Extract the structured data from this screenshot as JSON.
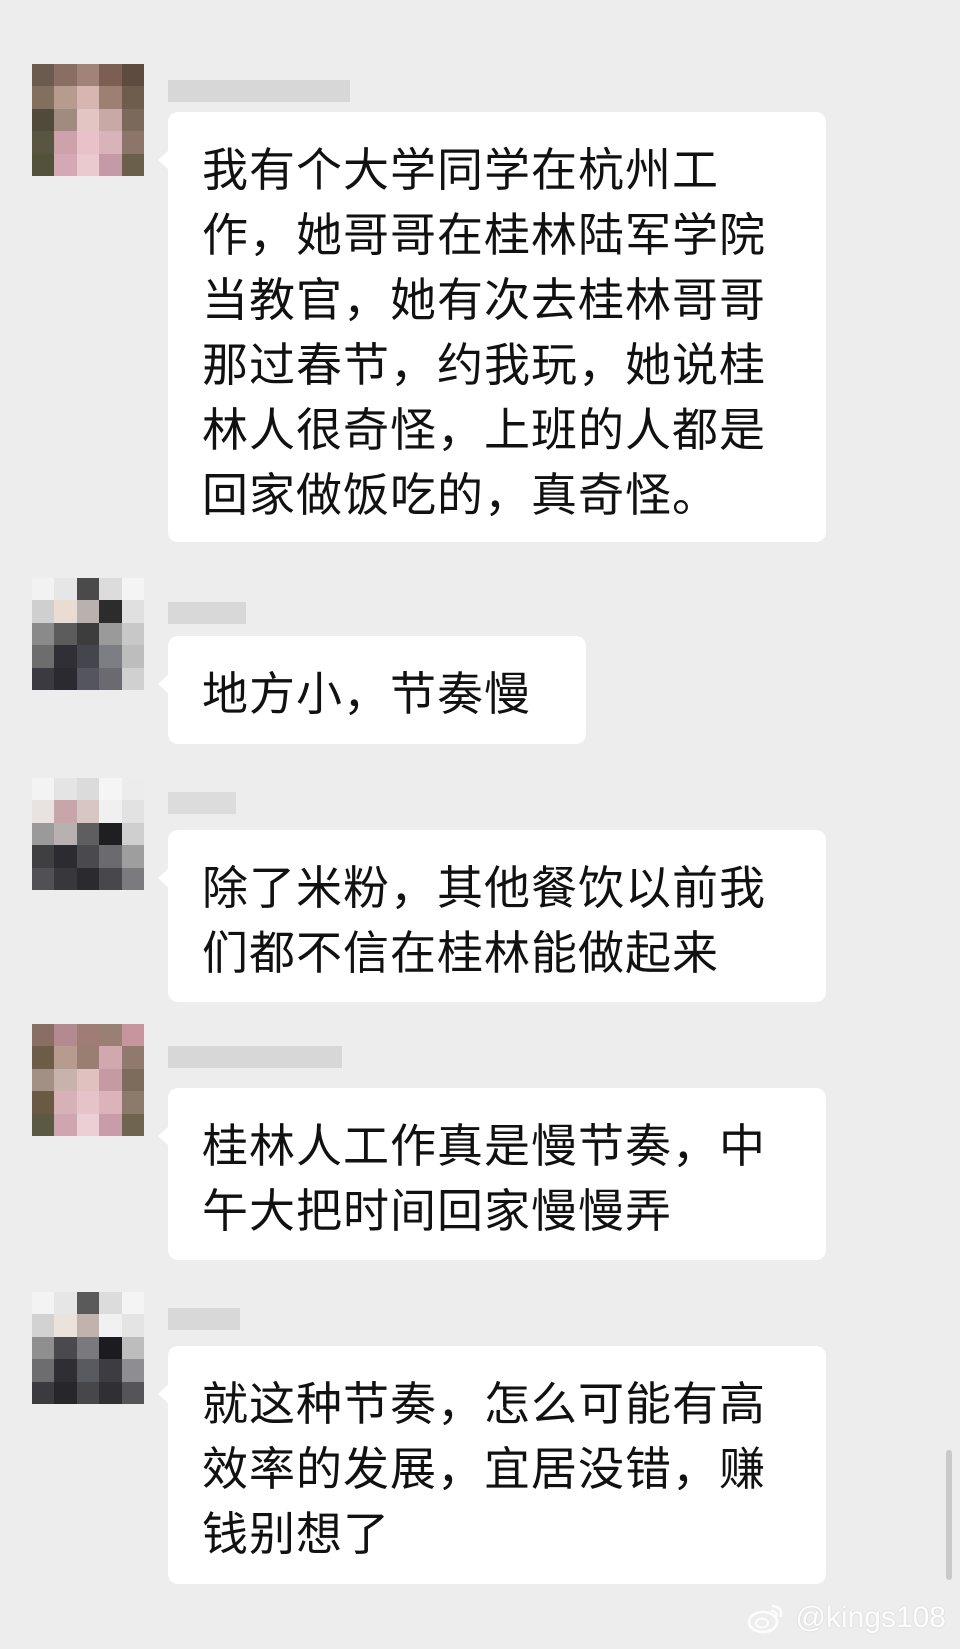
{
  "chat": {
    "messages": [
      {
        "text": "我有个大学同学在杭州工作，她哥哥在桂林陆军学院当教官，她有次去桂林哥哥那过春节，约我玩，她说桂林人很奇怪，上班的人都是回家做饭吃的，真奇怪。"
      },
      {
        "text": "地方小，节奏慢"
      },
      {
        "text": "除了米粉，其他餐饮以前我们都不信在桂林能做起来"
      },
      {
        "text": "桂林人工作真是慢节奏，中午大把时间回家慢慢弄"
      },
      {
        "text": "就这种节奏，怎么可能有高效率的发展，宜居没错，赚钱别想了"
      }
    ]
  },
  "watermark": {
    "icon": "weibo-icon",
    "text": "@kings108"
  },
  "colors": {
    "background": "#ededed",
    "bubble": "#ffffff",
    "text": "#111111"
  }
}
